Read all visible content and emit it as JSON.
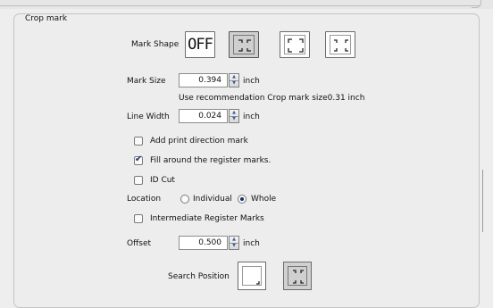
{
  "panel": {
    "title": "Crop mark"
  },
  "mark_shape": {
    "label": "Mark Shape",
    "options": [
      {
        "name": "off",
        "text": "OFF",
        "selected": false
      },
      {
        "name": "japanese-style",
        "selected": true
      },
      {
        "name": "corner-outward",
        "selected": false
      },
      {
        "name": "corner-inward",
        "selected": false
      }
    ]
  },
  "mark_size": {
    "label": "Mark Size",
    "value": "0.394",
    "unit": "inch",
    "recommendation": "Use recommendation Crop mark size0.31 inch"
  },
  "line_width": {
    "label": "Line Width",
    "value": "0.024",
    "unit": "inch"
  },
  "checkboxes": {
    "print_direction": {
      "label": "Add print direction mark",
      "checked": false
    },
    "fill_around": {
      "label": "Fill around the register marks.",
      "checked": true
    },
    "id_cut": {
      "label": "ID Cut",
      "checked": false
    },
    "intermediate": {
      "label": "Intermediate Register Marks",
      "checked": false
    }
  },
  "location": {
    "label": "Location",
    "options": [
      {
        "label": "Individual",
        "selected": false
      },
      {
        "label": "Whole",
        "selected": true
      }
    ]
  },
  "offset": {
    "label": "Offset",
    "value": "0.500",
    "unit": "inch"
  },
  "search_position": {
    "label": "Search Position",
    "options": [
      {
        "name": "bottom-right",
        "selected": false
      },
      {
        "name": "four-corners",
        "selected": true
      }
    ]
  },
  "icons": {
    "spinner_up": "▲",
    "spinner_down": "▼"
  }
}
